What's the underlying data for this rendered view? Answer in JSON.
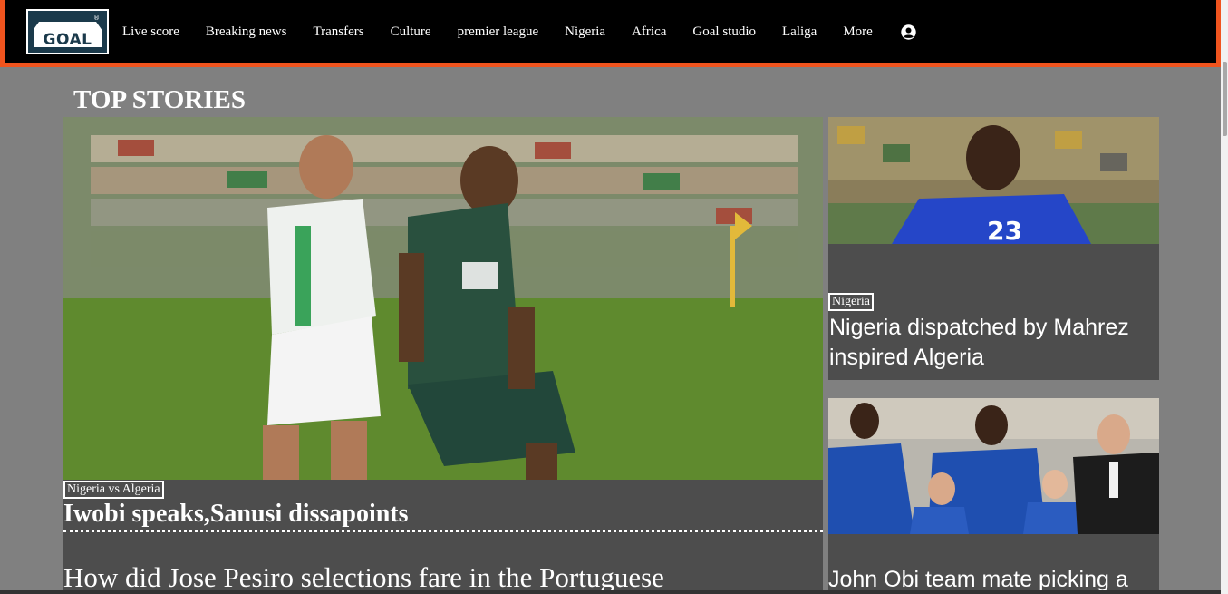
{
  "logo": {
    "text": "GOAL",
    "reg": "®"
  },
  "nav": {
    "items": [
      "Live score",
      "Breaking news",
      "Transfers",
      "Culture",
      "premier league",
      "Nigeria",
      "Africa",
      "Goal studio",
      "Laliga",
      "More"
    ],
    "account_icon": "user-circle-icon"
  },
  "section": {
    "title": "TOP STORIES"
  },
  "main_story": {
    "tag": "Nigeria vs Algeria",
    "headline": "Iwobi speaks,Sanusi dissapoints",
    "next_headline": "How did Jose Pesiro selections fare in the Portuguese"
  },
  "side_stories": [
    {
      "tag": "Nigeria",
      "headline": "Nigeria dispatched by Mahrez inspired Algeria"
    },
    {
      "headline": "John Obi team mate picking a"
    }
  ],
  "colors": {
    "accent": "#f0541e",
    "card": "#4d4d4d",
    "background": "#808080"
  }
}
